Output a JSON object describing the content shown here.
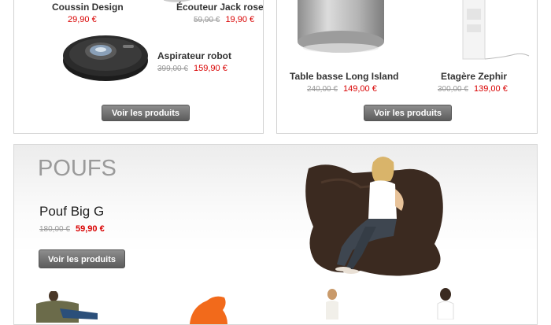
{
  "top_left": {
    "products": [
      {
        "name": "Coussin Design",
        "old_price": "",
        "new_price": "29,90 €"
      },
      {
        "name": "Écouteur Jack rose",
        "old_price": "59,90 €",
        "new_price": "19,90 €"
      },
      {
        "name": "Aspirateur robot",
        "old_price": "399,00 €",
        "new_price": "159,90 €"
      }
    ],
    "button": "Voir les produits"
  },
  "top_right": {
    "products": [
      {
        "name": "Table basse Long Island",
        "old_price": "240,00 €",
        "new_price": "149,00 €"
      },
      {
        "name": "Etagère Zephir",
        "old_price": "300,00 €",
        "new_price": "139,00 €"
      }
    ],
    "button": "Voir les produits"
  },
  "poufs": {
    "title": "POUFS",
    "featured": {
      "name": "Pouf Big G",
      "old_price": "180,00 €",
      "new_price": "59,90 €"
    },
    "button": "Voir les produits"
  },
  "colors": {
    "accent_red": "#d90000",
    "button_gray": "#707070"
  },
  "icons": [
    "robot-vacuum-image",
    "table-image",
    "shelf-image",
    "beanbag-image"
  ]
}
